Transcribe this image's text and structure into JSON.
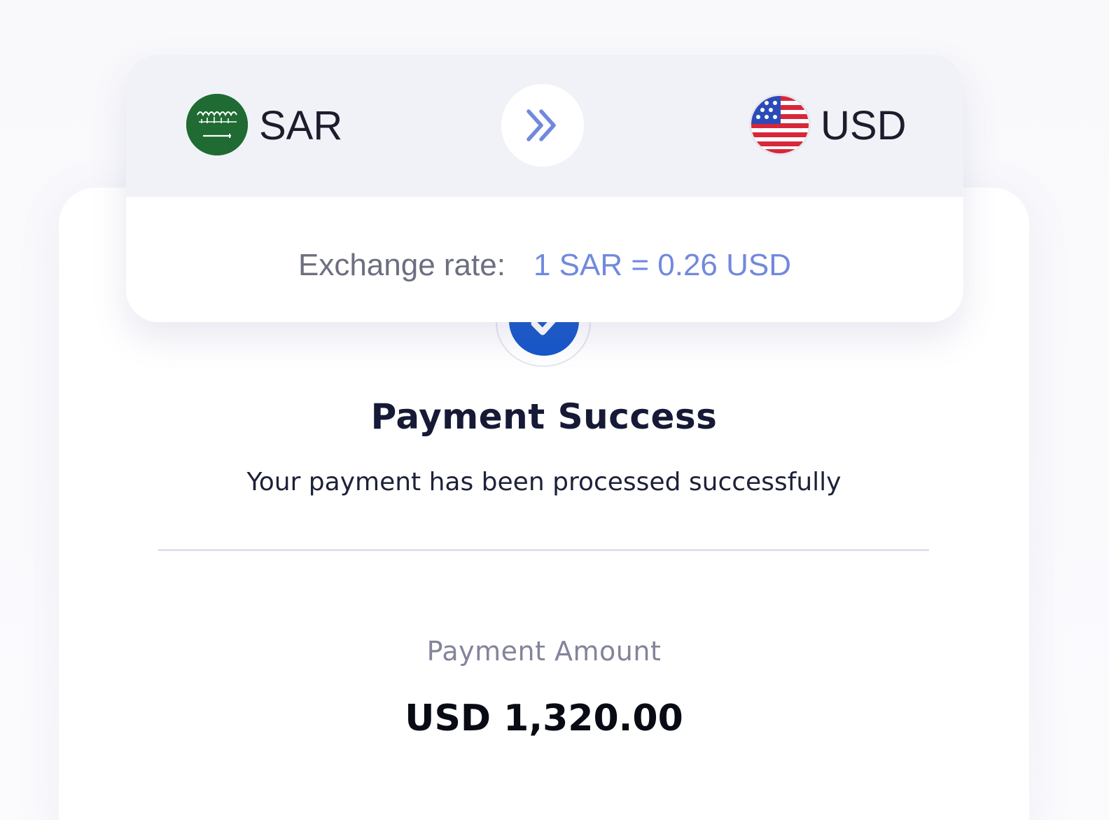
{
  "exchange": {
    "from_currency": "SAR",
    "to_currency": "USD",
    "rate_label": "Exchange rate:",
    "rate_value": "1 SAR = 0.26 USD"
  },
  "icons": {
    "from_flag": "saudi-arabia-flag-icon",
    "to_flag": "united-states-flag-icon",
    "swap": "double-chevron-right-icon",
    "status": "checkmark-icon"
  },
  "result": {
    "title": "Payment Success",
    "message": "Your payment has been processed successfully",
    "amount_label": "Payment Amount",
    "amount_value": "USD 1,320.00"
  },
  "colors": {
    "accent": "#7189dd",
    "success_badge": "#1556c9",
    "heading": "#161a36",
    "header_background": "#f1f2f8"
  }
}
